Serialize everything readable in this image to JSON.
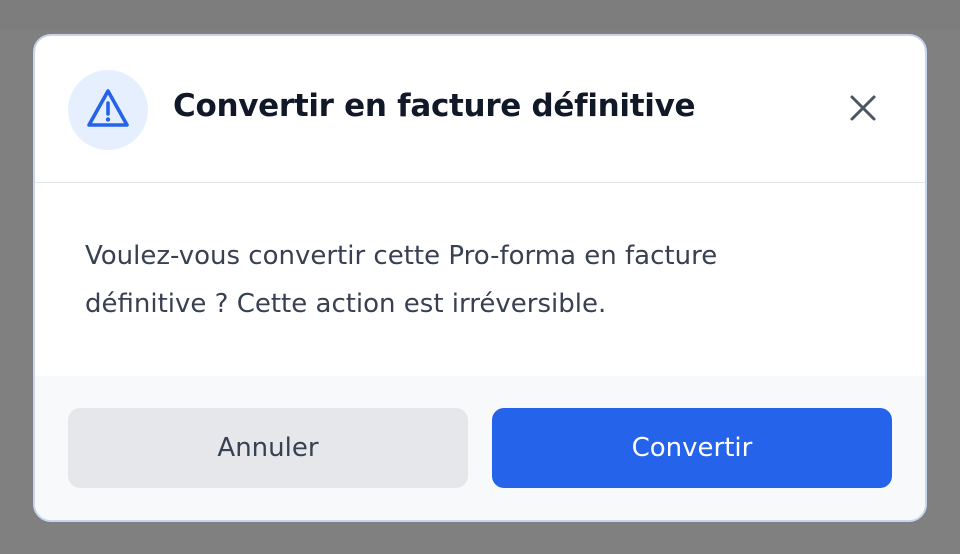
{
  "dialog": {
    "title": "Convertir en facture définitive",
    "icon": "warning-triangle-icon",
    "close_icon": "close-icon",
    "message": "Voulez-vous convertir cette Pro-forma en facture définitive ? Cette action est irréversible.",
    "cancel_label": "Annuler",
    "confirm_label": "Convertir"
  },
  "colors": {
    "accent": "#2563eb",
    "overlay": "#7f7f7f",
    "icon_badge_bg": "#e6effd",
    "cancel_bg": "#e5e7eb"
  }
}
